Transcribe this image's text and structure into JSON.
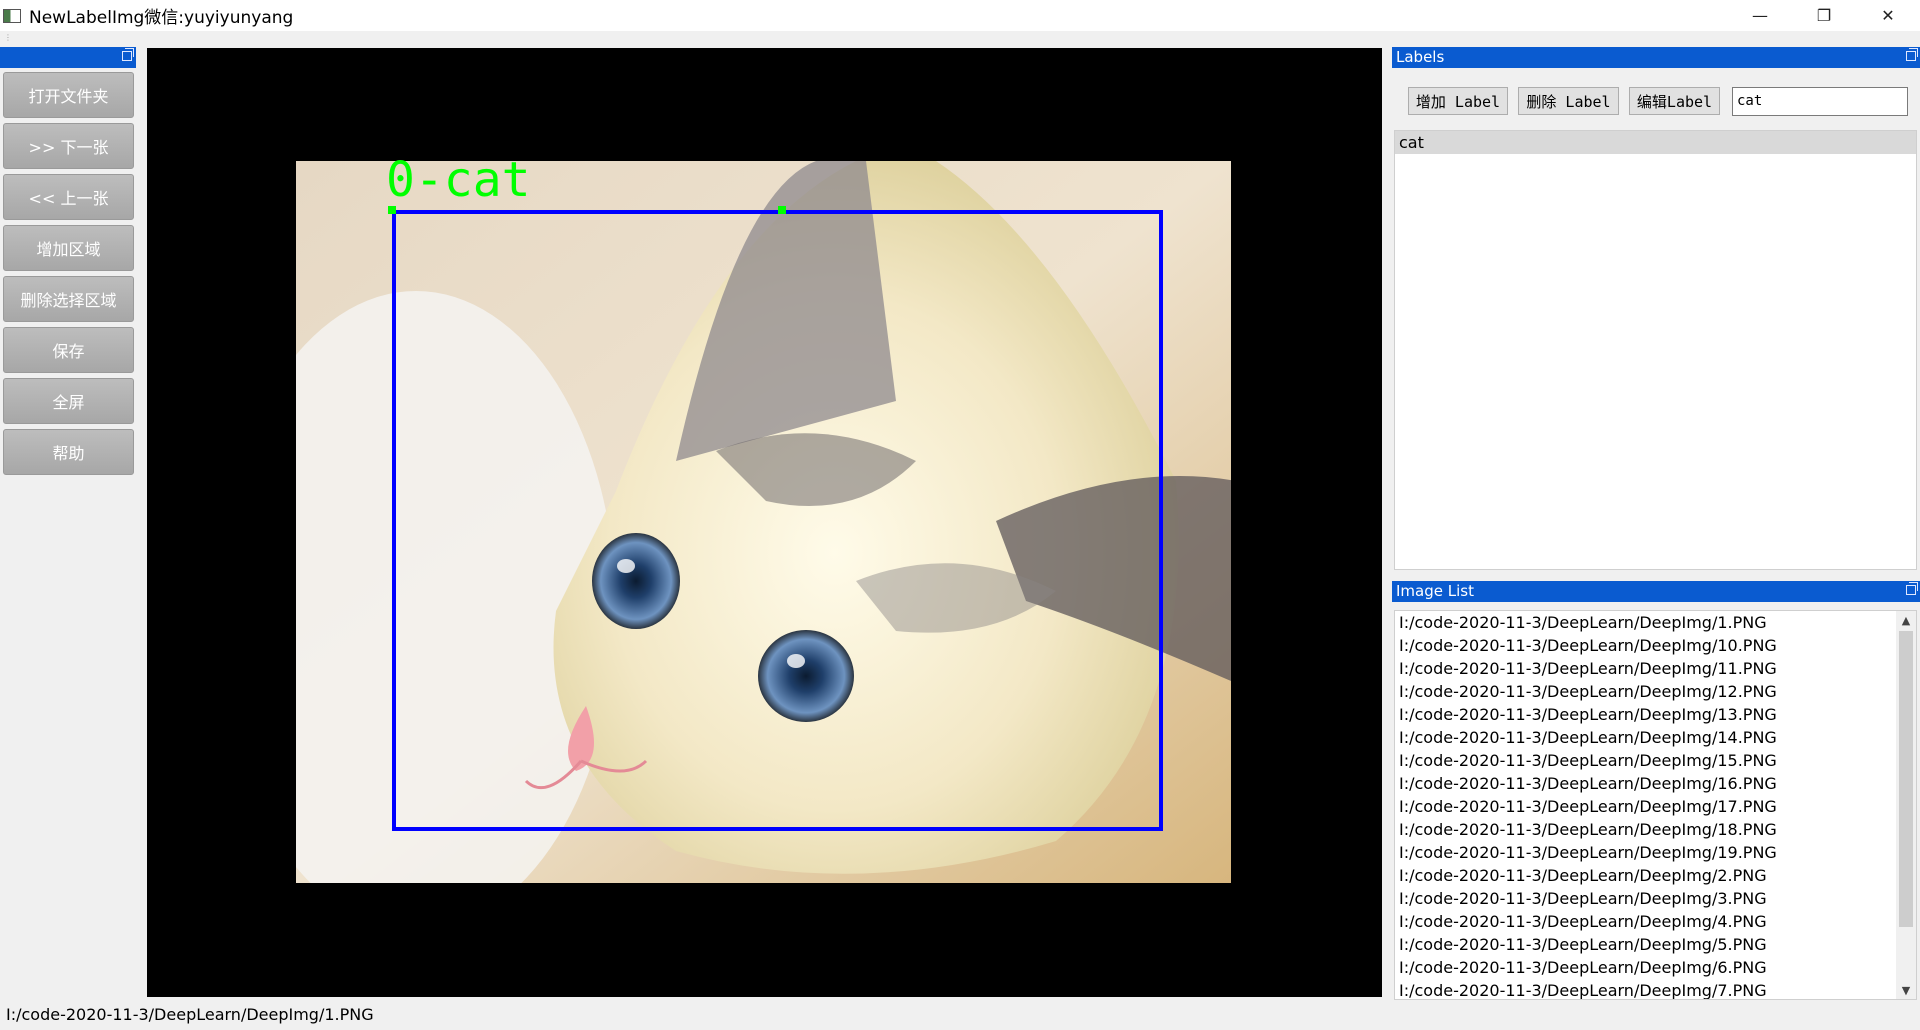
{
  "window": {
    "title": "NewLabelImg微信:yuyiyunyang",
    "minimize_icon": "minimize-icon",
    "restore_icon": "restore-icon",
    "close_icon": "close-icon"
  },
  "left_panel": {
    "buttons": [
      {
        "label": "打开文件夹"
      },
      {
        "label": ">> 下一张"
      },
      {
        "label": "<< 上一张"
      },
      {
        "label": "增加区域"
      },
      {
        "label": "删除选择区域"
      },
      {
        "label": "保存"
      },
      {
        "label": "全屏"
      },
      {
        "label": "帮助"
      }
    ]
  },
  "canvas": {
    "annotation_label": "0-cat",
    "box_color": "#0000ff",
    "label_color": "#00ff00"
  },
  "labels_panel": {
    "title": "Labels",
    "add_label": "增加 Label",
    "delete_label": "删除 Label",
    "edit_label": "编辑Label",
    "input_value": "cat",
    "items": [
      "cat"
    ]
  },
  "image_list_panel": {
    "title": "Image List",
    "items": [
      "I:/code-2020-11-3/DeepLearn/DeepImg/1.PNG",
      "I:/code-2020-11-3/DeepLearn/DeepImg/10.PNG",
      "I:/code-2020-11-3/DeepLearn/DeepImg/11.PNG",
      "I:/code-2020-11-3/DeepLearn/DeepImg/12.PNG",
      "I:/code-2020-11-3/DeepLearn/DeepImg/13.PNG",
      "I:/code-2020-11-3/DeepLearn/DeepImg/14.PNG",
      "I:/code-2020-11-3/DeepLearn/DeepImg/15.PNG",
      "I:/code-2020-11-3/DeepLearn/DeepImg/16.PNG",
      "I:/code-2020-11-3/DeepLearn/DeepImg/17.PNG",
      "I:/code-2020-11-3/DeepLearn/DeepImg/18.PNG",
      "I:/code-2020-11-3/DeepLearn/DeepImg/19.PNG",
      "I:/code-2020-11-3/DeepLearn/DeepImg/2.PNG",
      "I:/code-2020-11-3/DeepLearn/DeepImg/3.PNG",
      "I:/code-2020-11-3/DeepLearn/DeepImg/4.PNG",
      "I:/code-2020-11-3/DeepLearn/DeepImg/5.PNG",
      "I:/code-2020-11-3/DeepLearn/DeepImg/6.PNG",
      "I:/code-2020-11-3/DeepLearn/DeepImg/7.PNG"
    ]
  },
  "status_bar": {
    "text": "I:/code-2020-11-3/DeepLearn/DeepImg/1.PNG"
  },
  "accent_color": "#0a5bd0"
}
